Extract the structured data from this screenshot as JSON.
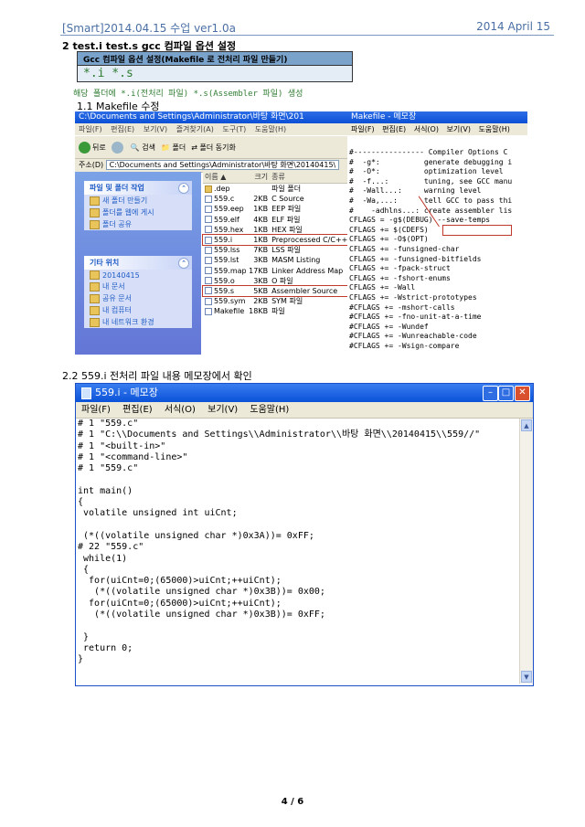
{
  "header": {
    "left": "[Smart]2014.04.15 수업 ver1.0a",
    "right": "2014 April 15"
  },
  "section2_title": "2 test.i   test.s   gcc 컴파일 옵션 설정",
  "gcc_box": {
    "title": "Gcc 컴파일 옵션 설정(Makefile 로 전처리 파일 만들기)",
    "content": "*.i *.s"
  },
  "gen_note": "해당 폴더에 *.i(전처리 파일) *.s(Assembler 파일) 생성",
  "section_1_1": "1.1 Makefile 수정",
  "explorer": {
    "title": "C:\\Documents and Settings\\Administrator\\바탕 화면\\201",
    "menu": [
      "파일(F)",
      "편집(E)",
      "보기(V)",
      "즐겨찾기(A)",
      "도구(T)",
      "도움말(H)"
    ],
    "toolbar": {
      "back": "뒤로",
      "search": "검색",
      "folders": "폴더",
      "sync": "폴더 동기화"
    },
    "address_label": "주소(D)",
    "address": "C:\\Documents and Settings\\Administrator\\바탕 화면\\20140415\\",
    "tasks_title": "파일 및 폴더 작업",
    "tasks": [
      "새 폴더 만들기",
      "폴더를 웹에 게시",
      "폴더 공유"
    ],
    "places_title": "기타 위치",
    "places": [
      "20140415",
      "내 문서",
      "공유 문서",
      "내 컴퓨터",
      "내 네트워크 환경"
    ],
    "columns": [
      "이름 ▲",
      "크기",
      "종류"
    ],
    "files": [
      {
        "name": ".dep",
        "size": "",
        "type": "파일 폴더"
      },
      {
        "name": "559.c",
        "size": "2KB",
        "type": "C Source"
      },
      {
        "name": "559.eep",
        "size": "1KB",
        "type": "EEP 파일"
      },
      {
        "name": "559.elf",
        "size": "4KB",
        "type": "ELF 파일"
      },
      {
        "name": "559.hex",
        "size": "1KB",
        "type": "HEX 파일"
      },
      {
        "name": "559.i",
        "size": "1KB",
        "type": "Preprocessed C/C++"
      },
      {
        "name": "559.lss",
        "size": "7KB",
        "type": "LSS 파일"
      },
      {
        "name": "559.lst",
        "size": "3KB",
        "type": "MASM Listing"
      },
      {
        "name": "559.map",
        "size": "17KB",
        "type": "Linker Address Map"
      },
      {
        "name": "559.o",
        "size": "3KB",
        "type": "O 파일"
      },
      {
        "name": "559.s",
        "size": "5KB",
        "type": "Assembler Source"
      },
      {
        "name": "559.sym",
        "size": "2KB",
        "type": "SYM 파일"
      },
      {
        "name": "Makefile",
        "size": "18KB",
        "type": "파일"
      }
    ]
  },
  "makefile_notepad": {
    "title": "Makefile - 메모장",
    "menu": [
      "파일(F)",
      "편집(E)",
      "서식(O)",
      "보기(V)",
      "도움말(H)"
    ],
    "text": "#---------------- Compiler Options C\n#  -g*:          generate debugging i\n#  -O*:          optimization level\n#  -f...:        tuning, see GCC manu\n#  -Wall...:     warning level\n#  -Wa,...:      tell GCC to pass thi\n#    -adhlns...: create assembler lis\nCFLAGS = -g$(DEBUG) --save-temps\nCFLAGS += $(CDEFS)\nCFLAGS += -O$(OPT)\nCFLAGS += -funsigned-char\nCFLAGS += -funsigned-bitfields\nCFLAGS += -fpack-struct\nCFLAGS += -fshort-enums\nCFLAGS += -Wall\nCFLAGS += -Wstrict-prototypes\n#CFLAGS += -mshort-calls\n#CFLAGS += -fno-unit-at-a-time\n#CFLAGS += -Wundef\n#CFLAGS += -Wunreachable-code\n#CFLAGS += -Wsign-compare"
  },
  "section_2_2": "2.2 559.i 전처리 파일 내용 메모장에서 확인",
  "notepad2": {
    "title": "559.i - 메모장",
    "menu": [
      "파일(F)",
      "편집(E)",
      "서식(O)",
      "보기(V)",
      "도움말(H)"
    ],
    "text": "# 1 \"559.c\"\n# 1 \"C:\\\\Documents and Settings\\\\Administrator\\\\바탕 화면\\\\20140415\\\\559//\"\n# 1 \"<built-in>\"\n# 1 \"<command-line>\"\n# 1 \"559.c\"\n\nint main()\n{\n volatile unsigned int uiCnt;\n\n (*((volatile unsigned char *)0x3A))= 0xFF;\n# 22 \"559.c\"\n while(1)\n {\n  for(uiCnt=0;(65000)>uiCnt;++uiCnt);\n   (*((volatile unsigned char *)0x3B))= 0x00;\n  for(uiCnt=0;(65000)>uiCnt;++uiCnt);\n   (*((volatile unsigned char *)0x3B))= 0xFF;\n\n }\n return 0;\n}"
  },
  "footer": "4 / 6"
}
